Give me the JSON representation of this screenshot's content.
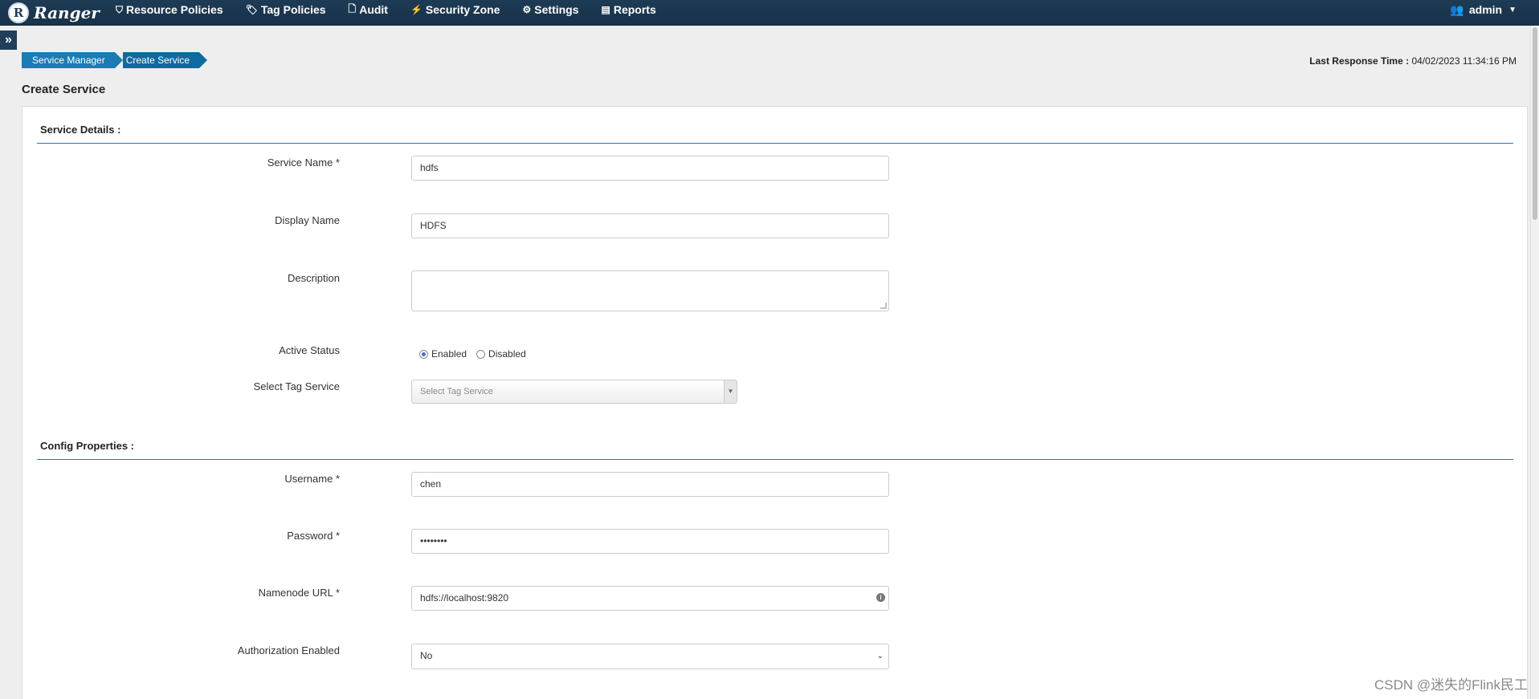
{
  "navbar": {
    "brand": "Ranger",
    "brand_logo": "R",
    "items": [
      {
        "label": "Resource Policies",
        "icon": "shield-icon",
        "glyph": "⛉"
      },
      {
        "label": "Tag Policies",
        "icon": "tags-icon",
        "glyph": "🏷"
      },
      {
        "label": "Audit",
        "icon": "file-icon",
        "glyph": "🗋"
      },
      {
        "label": "Security Zone",
        "icon": "zone-icon",
        "glyph": "⚡"
      },
      {
        "label": "Settings",
        "icon": "gear-icon",
        "glyph": "⚙"
      },
      {
        "label": "Reports",
        "icon": "report-icon",
        "glyph": "▤"
      }
    ],
    "user": {
      "label": "admin",
      "icon": "users-icon",
      "glyph": "👥"
    }
  },
  "sidebar_toggle": {
    "icon": "double-chevron-right-icon",
    "glyph": "»"
  },
  "breadcrumb": [
    "Service Manager",
    "Create Service"
  ],
  "last_response": {
    "label": "Last Response Time :",
    "value": "04/02/2023 11:34:16 PM"
  },
  "page_title": "Create Service",
  "service_details": {
    "title": "Service Details :",
    "service_name": {
      "label": "Service Name *",
      "value": "hdfs"
    },
    "display_name": {
      "label": "Display Name",
      "value": "HDFS"
    },
    "description": {
      "label": "Description",
      "value": ""
    },
    "active_status": {
      "label": "Active Status",
      "options": [
        "Enabled",
        "Disabled"
      ],
      "selected": "Enabled"
    },
    "tag_service": {
      "label": "Select Tag Service",
      "placeholder": "Select Tag Service"
    }
  },
  "config_properties": {
    "title": "Config Properties :",
    "username": {
      "label": "Username *",
      "value": "chen"
    },
    "password": {
      "label": "Password *",
      "value": "••••••••"
    },
    "namenode_url": {
      "label": "Namenode URL *",
      "value": "hdfs://localhost:9820"
    },
    "authorization_enabled": {
      "label": "Authorization Enabled",
      "value": "No"
    }
  },
  "watermark": "CSDN @迷失的Flink民工"
}
